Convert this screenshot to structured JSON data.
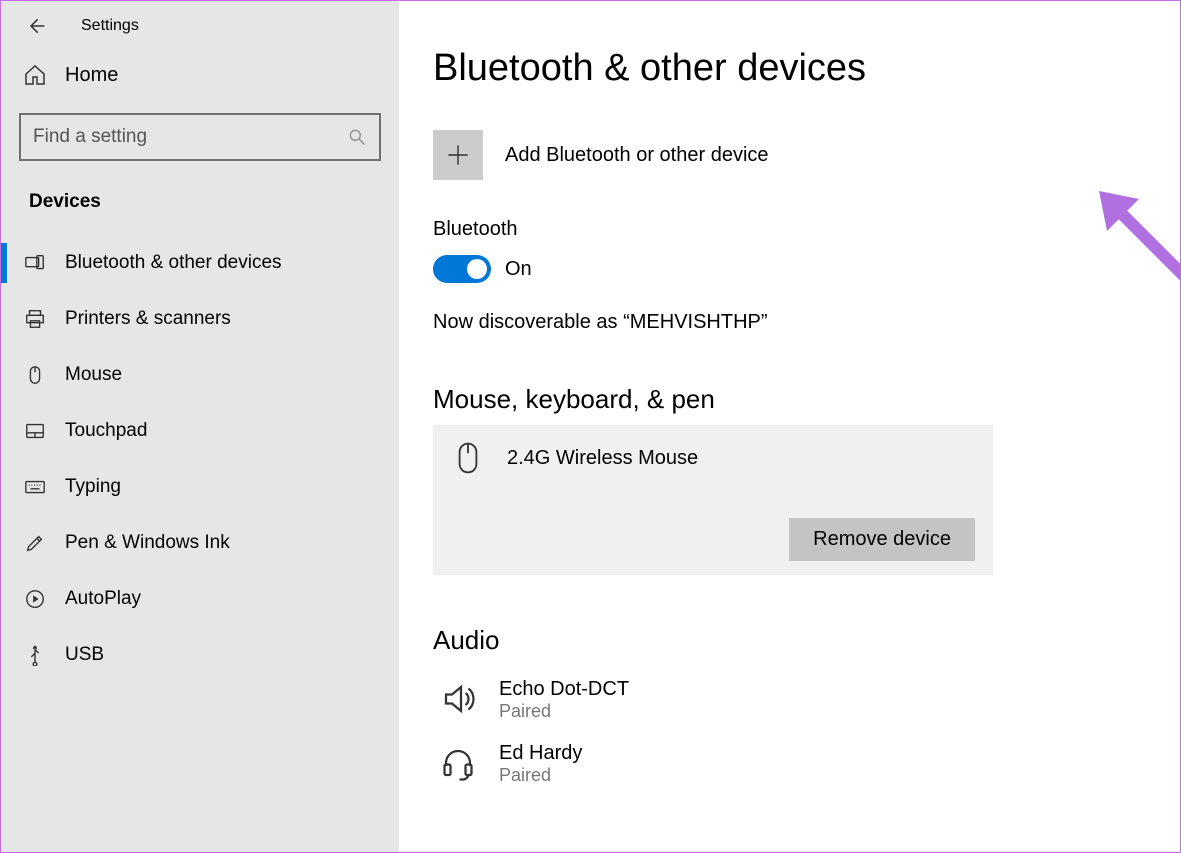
{
  "header": {
    "app_title": "Settings"
  },
  "sidebar": {
    "home_label": "Home",
    "search_placeholder": "Find a setting",
    "category": "Devices",
    "items": [
      {
        "label": "Bluetooth & other devices",
        "icon": "devices",
        "selected": true
      },
      {
        "label": "Printers & scanners",
        "icon": "printer",
        "selected": false
      },
      {
        "label": "Mouse",
        "icon": "mouse",
        "selected": false
      },
      {
        "label": "Touchpad",
        "icon": "touchpad",
        "selected": false
      },
      {
        "label": "Typing",
        "icon": "keyboard",
        "selected": false
      },
      {
        "label": "Pen & Windows Ink",
        "icon": "pen",
        "selected": false
      },
      {
        "label": "AutoPlay",
        "icon": "autoplay",
        "selected": false
      },
      {
        "label": "USB",
        "icon": "usb",
        "selected": false
      }
    ]
  },
  "main": {
    "title": "Bluetooth & other devices",
    "add_label": "Add Bluetooth or other device",
    "bluetooth": {
      "heading": "Bluetooth",
      "state": "On",
      "discoverable": "Now discoverable as “MEHVISHTHP”"
    },
    "mouse_section": {
      "title": "Mouse, keyboard, & pen",
      "device_name": "2.4G Wireless Mouse",
      "remove_label": "Remove device"
    },
    "audio_section": {
      "title": "Audio",
      "items": [
        {
          "name": "Echo Dot-DCT",
          "status": "Paired",
          "icon": "speaker"
        },
        {
          "name": "Ed Hardy",
          "status": "Paired",
          "icon": "headset"
        }
      ]
    }
  },
  "annotation": {
    "arrow_color": "#b070e0"
  }
}
